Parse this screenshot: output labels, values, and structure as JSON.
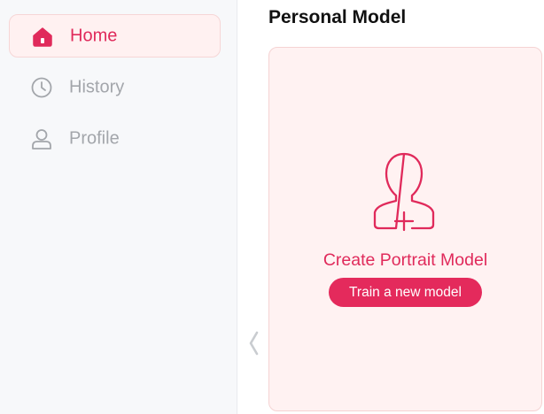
{
  "sidebar": {
    "items": [
      {
        "label": "Home",
        "icon": "home-icon",
        "active": true
      },
      {
        "label": "History",
        "icon": "clock-icon",
        "active": false
      },
      {
        "label": "Profile",
        "icon": "user-icon",
        "active": false
      }
    ]
  },
  "main": {
    "title": "Personal Model",
    "card": {
      "icon": "portrait-add-icon",
      "title": "Create Portrait Model",
      "button_label": "Train a new model"
    }
  },
  "colors": {
    "accent": "#e02a5b",
    "button": "#e42a5c",
    "card_background": "#fff2f2",
    "sidebar_background": "#f7f8fa",
    "inactive_text": "#a3a6ab"
  }
}
